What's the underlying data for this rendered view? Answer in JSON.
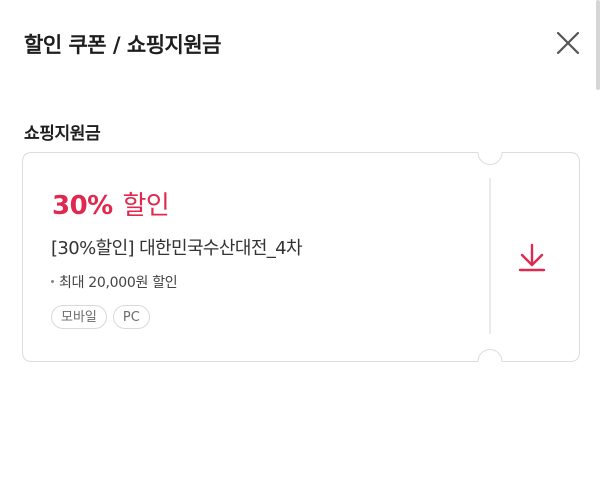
{
  "header": {
    "title": "할인 쿠폰 / 쇼핑지원금",
    "close_icon": "close-icon"
  },
  "section": {
    "title": "쇼핑지원금"
  },
  "coupon": {
    "rate": "30%",
    "rate_unit": "할인",
    "name": "[30%할인] 대한민국수산대전_4차",
    "limit": "최대 20,000원 할인",
    "tags": [
      "모바일",
      "PC"
    ],
    "download_icon": "download-icon",
    "accent_color": "#e0294e"
  }
}
